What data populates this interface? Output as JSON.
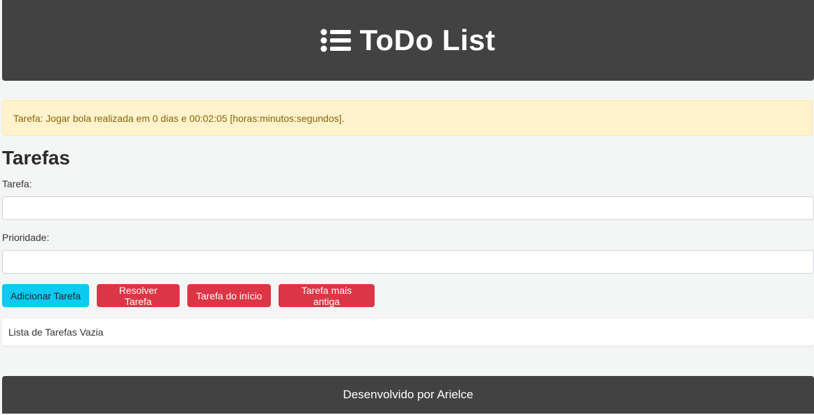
{
  "header": {
    "icon": "list-icon",
    "title": "ToDo List"
  },
  "alert": {
    "message": "Tarefa: Jogar bola realizada em 0 dias e 00:02:05 [horas:minutos:segundos]."
  },
  "form": {
    "section_title": "Tarefas",
    "task_label": "Tarefa:",
    "task_value": "",
    "priority_label": "Prioridade:",
    "priority_value": ""
  },
  "buttons": {
    "add": "Adicionar Tarefa",
    "resolve": "Resolver Tarefa",
    "first": "Tarefa do início",
    "oldest": "Tarefa mais antiga"
  },
  "task_list": {
    "empty_message": "Lista de Tarefas Vazia"
  },
  "footer": {
    "text": "Desenvolvido por Arielce"
  },
  "colors": {
    "header_bg": "#424242",
    "alert_bg": "#fff3cd",
    "info": "#0dcaf0",
    "danger": "#dc3545"
  }
}
